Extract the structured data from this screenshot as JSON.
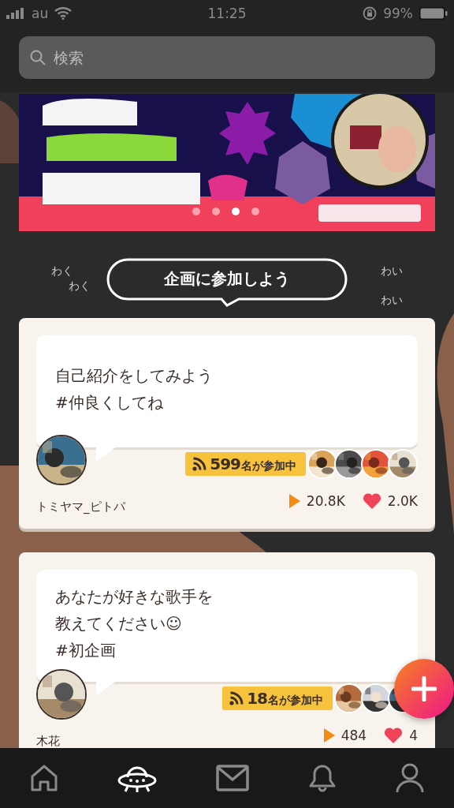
{
  "status_bar": {
    "carrier": "au",
    "time": "11:25",
    "battery": "99%"
  },
  "search": {
    "placeholder": "検索"
  },
  "banner": {
    "kind": "picture",
    "dots": [
      {
        "selected": false
      },
      {
        "selected": false
      },
      {
        "selected": true
      },
      {
        "selected": false
      }
    ]
  },
  "prompt": {
    "left_lines": [
      "わく",
      "わく"
    ],
    "title": "企画に参加しよう",
    "right_lines": [
      "わい",
      "わい"
    ]
  },
  "cards": [
    {
      "text_lines": [
        "自己紹介をしてみよう",
        "#仲良くしてね"
      ],
      "author": "トミヤマ_ピトパ",
      "participant_count": "599",
      "participant_label": "名が参加中",
      "participant_avatars": [
        {
          "kind": "picture"
        },
        {
          "kind": "picture"
        },
        {
          "kind": "picture"
        },
        {
          "kind": "picture"
        }
      ],
      "plays": "20.8K",
      "likes": "2.0K"
    },
    {
      "text_lines": [
        "あなたが好きな歌手を",
        "教えてください☺",
        "#初企画"
      ],
      "author": "木花",
      "participant_count": "18",
      "participant_label": "名が参加中",
      "participant_avatars": [
        {
          "kind": "picture"
        },
        {
          "kind": "picture"
        },
        {
          "kind": "picture"
        }
      ],
      "plays": "484",
      "likes": "4"
    }
  ],
  "tabs": [
    {
      "selected": false
    },
    {
      "selected": true
    },
    {
      "selected": false
    },
    {
      "selected": false
    },
    {
      "selected": false
    }
  ]
}
